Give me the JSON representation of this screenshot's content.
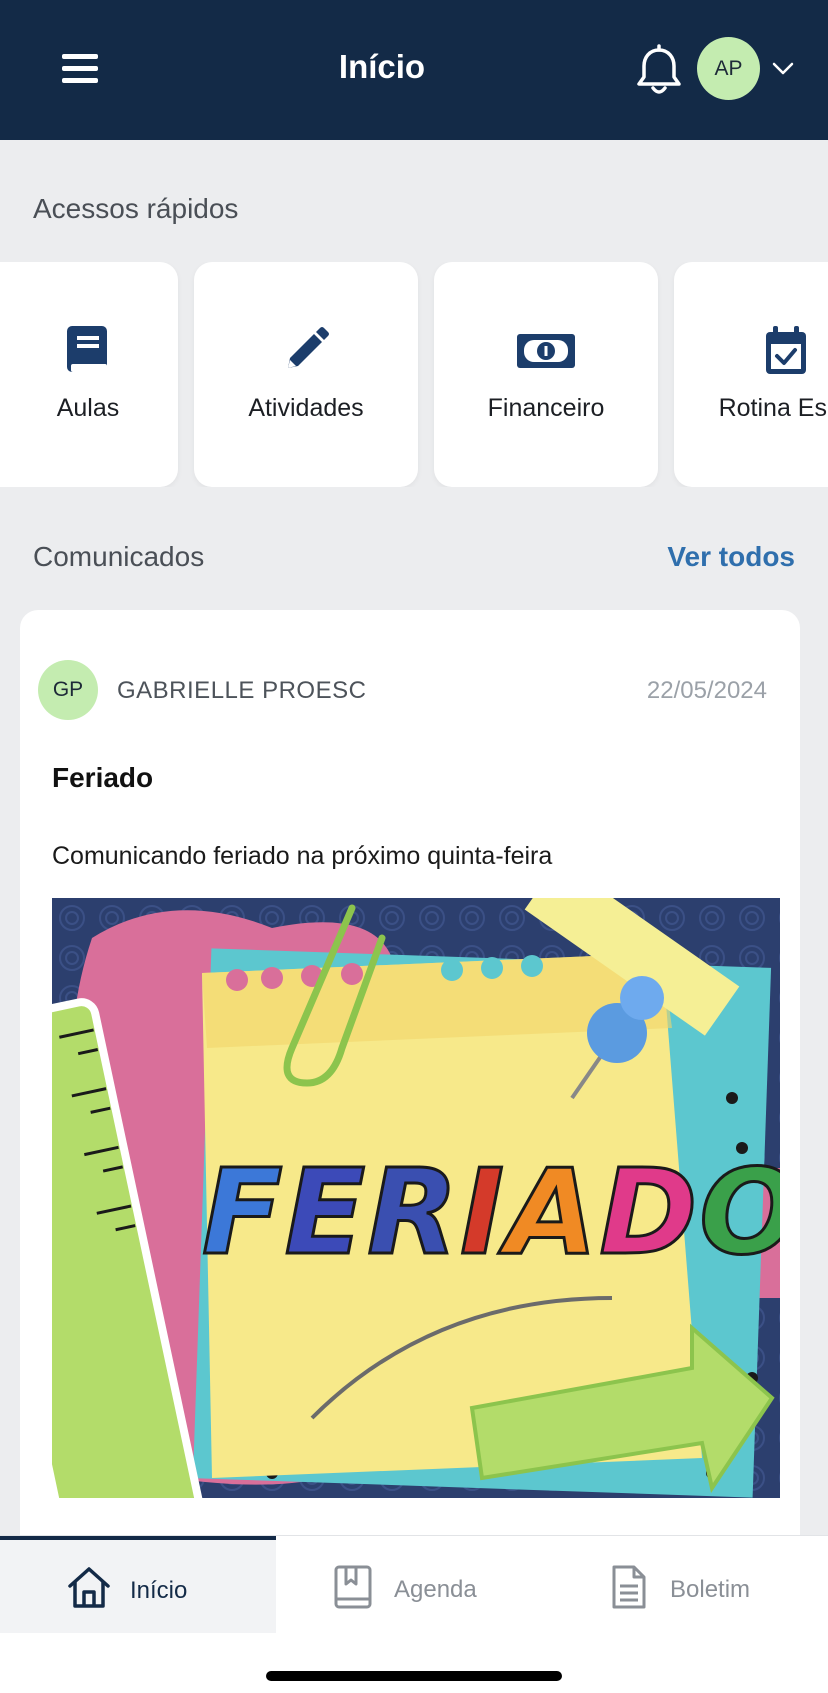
{
  "header": {
    "title": "Início",
    "avatar_initials": "AP"
  },
  "quick_access": {
    "heading": "Acessos rápidos",
    "items": [
      {
        "label": "Aulas",
        "icon": "book-icon"
      },
      {
        "label": "Atividades",
        "icon": "pencil-icon"
      },
      {
        "label": "Financeiro",
        "icon": "money-bill-icon"
      },
      {
        "label": "Rotina Esco",
        "icon": "calendar-check-icon"
      }
    ]
  },
  "announcements": {
    "heading": "Comunicados",
    "see_all": "Ver todos",
    "post": {
      "author_initials": "GP",
      "author": "GABRIELLE PROESC",
      "date": "22/05/2024",
      "title": "Feriado",
      "body": "Comunicando feriado na próximo quinta-feira",
      "image_text": "FERIADO"
    }
  },
  "bottom_nav": {
    "items": [
      {
        "label": "Início",
        "icon": "home-icon",
        "active": true
      },
      {
        "label": "Agenda",
        "icon": "agenda-book-icon",
        "active": false
      },
      {
        "label": "Boletim",
        "icon": "document-icon",
        "active": false
      }
    ]
  },
  "colors": {
    "header_bg": "#132a47",
    "accent_link": "#2f6fad",
    "avatar_bg": "#c4ecb0",
    "page_bg": "#ecedef"
  }
}
